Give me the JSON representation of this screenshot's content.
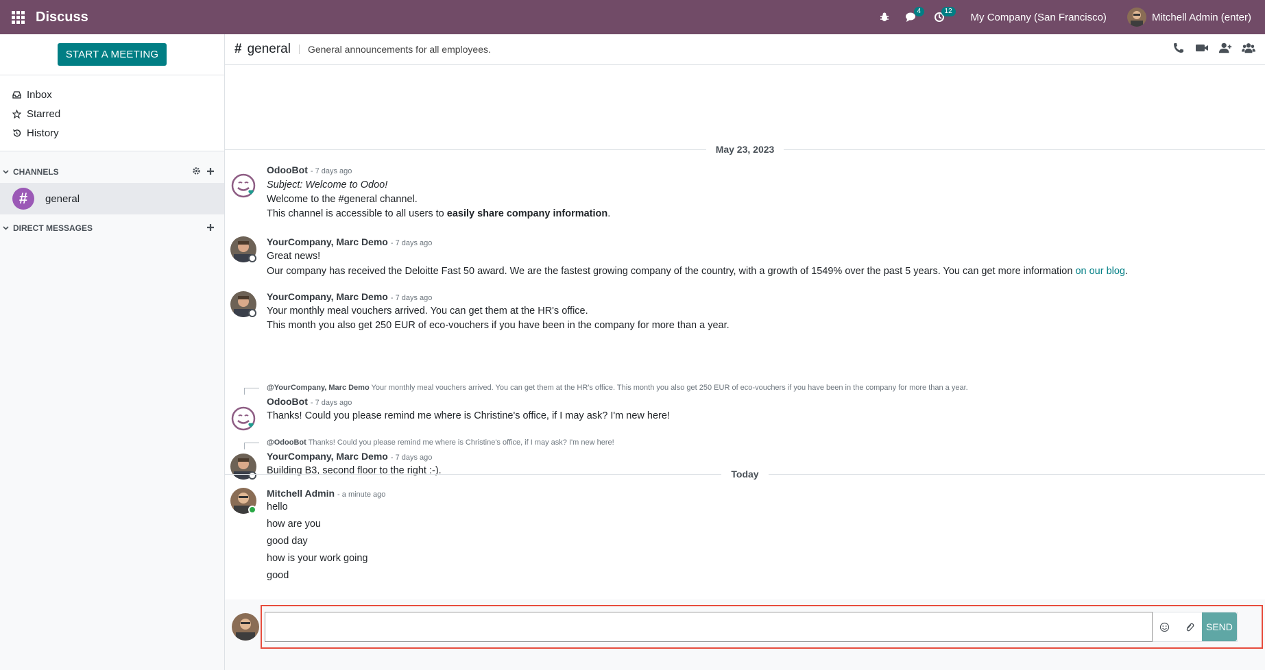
{
  "topbar": {
    "app_title": "Discuss",
    "messages_badge": "4",
    "activities_badge": "12",
    "company": "My Company (San Francisco)",
    "user": "Mitchell Admin (enter)"
  },
  "sidebar": {
    "start_meeting": "START A MEETING",
    "mailboxes": [
      {
        "label": "Inbox",
        "icon": "inbox-icon"
      },
      {
        "label": "Starred",
        "icon": "star-icon"
      },
      {
        "label": "History",
        "icon": "history-icon"
      }
    ],
    "channels_title": "CHANNELS",
    "channels": [
      {
        "name": "general",
        "avatar": "#"
      }
    ],
    "dm_title": "DIRECT MESSAGES"
  },
  "thread": {
    "hash": "#",
    "name": "general",
    "description": "General announcements for all employees."
  },
  "dates": {
    "first": "May 23, 2023",
    "today": "Today"
  },
  "messages": [
    {
      "author": "OdooBot",
      "ago": "- 7 days ago",
      "lines": [
        "Subject: Welcome to Odoo!",
        "Welcome to the #general channel.",
        "This channel is accessible to all users to ",
        "easily share company information",
        "."
      ]
    },
    {
      "author": "YourCompany, Marc Demo",
      "ago": "- 7 days ago",
      "lines": [
        "Great news!",
        "Our company has received the Deloitte Fast 50 award. We are the fastest growing company of the country, with a growth of 1549% over the past 5 years. You can get more information ",
        "on our blog",
        "."
      ]
    },
    {
      "author": "YourCompany, Marc Demo",
      "ago": "- 7 days ago",
      "lines": [
        "Your monthly meal vouchers arrived. You can get them at the HR's office.",
        "This month you also get 250 EUR of eco-vouchers if you have been in the company for more than a year."
      ]
    },
    {
      "reply_author": "@YourCompany, Marc Demo",
      "reply_text": " Your monthly meal vouchers arrived. You can get them at the HR's office. This month you also get 250 EUR of eco-vouchers if you have been in the company for more than a year.",
      "author": "OdooBot",
      "ago": "- 7 days ago",
      "lines": [
        "Thanks! Could you please remind me where is Christine's office, if I may ask? I'm new here!"
      ]
    },
    {
      "reply_author": "@OdooBot",
      "reply_text": " Thanks! Could you please remind me where is Christine's office, if I may ask? I'm new here!",
      "author": "YourCompany, Marc Demo",
      "ago": "- 7 days ago",
      "lines": [
        "Building B3, second floor to the right :-)."
      ]
    },
    {
      "author": "Mitchell Admin",
      "ago": "- a minute ago",
      "lines": [
        "hello",
        "how are you",
        "good day",
        "how is your work going",
        "good"
      ]
    }
  ],
  "composer": {
    "value": "",
    "send": "SEND"
  },
  "colors": {
    "brand": "#714b67",
    "accent": "#017e84",
    "highlight": "#e74c3c"
  }
}
